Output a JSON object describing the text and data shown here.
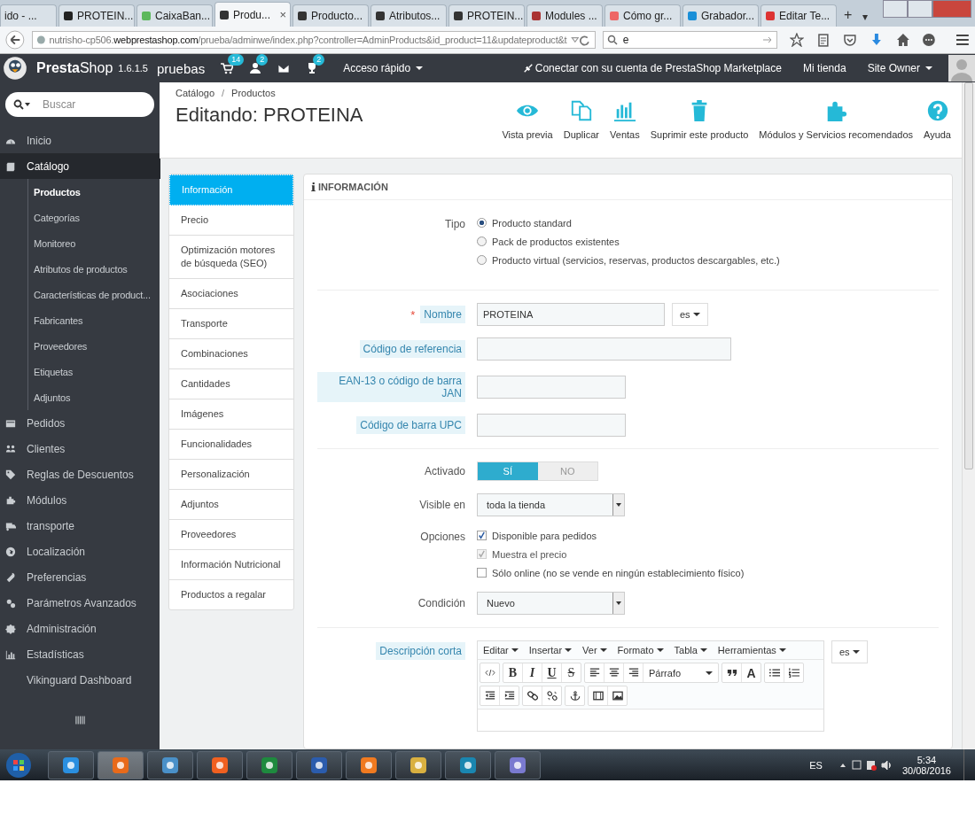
{
  "browser": {
    "tabs": [
      {
        "label": "ido - ...",
        "selected": false
      },
      {
        "label": "PROTEIN...",
        "selected": false
      },
      {
        "label": "CaixaBan...",
        "selected": false
      },
      {
        "label": "Produ...",
        "selected": true
      },
      {
        "label": "Producto...",
        "selected": false
      },
      {
        "label": "Atributos...",
        "selected": false
      },
      {
        "label": "PROTEIN...",
        "selected": false
      },
      {
        "label": "Modules ...",
        "selected": false
      },
      {
        "label": "Cómo gr...",
        "selected": false
      },
      {
        "label": "Grabador...",
        "selected": false
      },
      {
        "label": "Editar Te...",
        "selected": false
      }
    ],
    "close_glyph": "×",
    "new_tab_glyph": "+",
    "menu_glyph": "▾",
    "url": "nutrisho-cp506.**webprestashop.com**/prueba/adminwe/index.php?controller=AdminProducts&id_product=11&updateproduct&t",
    "search_value": "e"
  },
  "ps_header": {
    "brand": "**Presta**Shop",
    "version": "1.6.1.5",
    "shop": "pruebas",
    "orders_count": "14",
    "customers_count": "2",
    "trophies_count": "2",
    "quick_access": "Acceso rápido",
    "connect": "Conectar con su cuenta de PrestaShop Marketplace",
    "my_shop": "Mi tienda",
    "user": "Site Owner"
  },
  "sidebar": {
    "search_placeholder": "Buscar",
    "items": [
      {
        "label": "Inicio",
        "selected": false
      },
      {
        "label": "Catálogo",
        "selected": true,
        "children": [
          {
            "label": "Productos",
            "selected": true
          },
          {
            "label": "Categorías",
            "selected": false
          },
          {
            "label": "Monitoreo",
            "selected": false
          },
          {
            "label": "Atributos de productos",
            "selected": false
          },
          {
            "label": "Características de product...",
            "selected": false
          },
          {
            "label": "Fabricantes",
            "selected": false
          },
          {
            "label": "Proveedores",
            "selected": false
          },
          {
            "label": "Etiquetas",
            "selected": false
          },
          {
            "label": "Adjuntos",
            "selected": false
          }
        ]
      },
      {
        "label": "Pedidos",
        "selected": false
      },
      {
        "label": "Clientes",
        "selected": false
      },
      {
        "label": "Reglas de Descuentos",
        "selected": false
      },
      {
        "label": "Módulos",
        "selected": false
      },
      {
        "label": "transporte",
        "selected": false
      },
      {
        "label": "Localización",
        "selected": false
      },
      {
        "label": "Preferencias",
        "selected": false
      },
      {
        "label": "Parámetros Avanzados",
        "selected": false
      },
      {
        "label": "Administración",
        "selected": false
      },
      {
        "label": "Estadísticas",
        "selected": false
      },
      {
        "label": "Vikinguard Dashboard",
        "selected": false
      }
    ]
  },
  "page": {
    "breadcrumb": [
      "Catálogo",
      "Productos"
    ],
    "breadcrumb_separator": "/",
    "title": "Editando: PROTEINA",
    "toolbar": [
      {
        "label": "Vista previa"
      },
      {
        "label": "Duplicar"
      },
      {
        "label": "Ventas"
      },
      {
        "label": "Suprimir este producto"
      },
      {
        "label": "Módulos y Servicios recomendados"
      },
      {
        "label": "Ayuda"
      }
    ]
  },
  "tabs": [
    {
      "label": "Información",
      "selected": true
    },
    {
      "label": "Precio",
      "selected": false
    },
    {
      "label": "Optimización motores de búsqueda (SEO)",
      "selected": false
    },
    {
      "label": "Asociaciones",
      "selected": false
    },
    {
      "label": "Transporte",
      "selected": false
    },
    {
      "label": "Combinaciones",
      "selected": false
    },
    {
      "label": "Cantidades",
      "selected": false
    },
    {
      "label": "Imágenes",
      "selected": false
    },
    {
      "label": "Funcionalidades",
      "selected": false
    },
    {
      "label": "Personalización",
      "selected": false
    },
    {
      "label": "Adjuntos",
      "selected": false
    },
    {
      "label": "Proveedores",
      "selected": false
    },
    {
      "label": "Información Nutricional",
      "selected": false
    },
    {
      "label": "Productos a regalar",
      "selected": false
    }
  ],
  "panel": {
    "heading": "INFORMACIÓN",
    "required_mark": "*",
    "type_field": {
      "label": "Tipo",
      "options": [
        {
          "label": "Producto standard",
          "selected": true
        },
        {
          "label": "Pack de productos existentes",
          "selected": false
        },
        {
          "label": "Producto virtual (servicios, reservas, productos descargables, etc.)",
          "selected": false
        }
      ]
    },
    "identity_fields": [
      {
        "label": "Nombre",
        "required": true,
        "value": "PROTEINA",
        "lang": "es"
      },
      {
        "label": "Código de referencia",
        "required": false
      },
      {
        "label": "EAN-13 o código de barra JAN",
        "required": false
      },
      {
        "label": "Código de barra UPC",
        "required": false
      }
    ],
    "active": {
      "label": "Activado",
      "options": [
        {
          "label": "SÍ",
          "selected": true
        },
        {
          "label": "NO",
          "selected": false
        }
      ]
    },
    "visibility": {
      "label": "Visible en",
      "value": "toda la tienda"
    },
    "options": {
      "label": "Opciones",
      "items": [
        {
          "label": "Disponible para pedidos",
          "checked": true,
          "disabled": false
        },
        {
          "label": "Muestra el precio",
          "checked": true,
          "disabled": true
        },
        {
          "label": "Sólo online (no se vende en ningún establecimiento físico)",
          "checked": false,
          "disabled": false
        }
      ]
    },
    "condition": {
      "label": "Condición",
      "value": "Nuevo"
    },
    "short_description": {
      "label": "Descripción corta",
      "lang": "es",
      "menus": [
        "Editar",
        "Insertar",
        "Ver",
        "Formato",
        "Tabla",
        "Herramientas"
      ],
      "format_buttons": [
        "B",
        "I",
        "U",
        "S"
      ],
      "block_format": "Párrafo",
      "text_color_button": "A"
    }
  },
  "taskbar": {
    "language": "ES",
    "time": "5:34",
    "date": "30/08/2016"
  }
}
